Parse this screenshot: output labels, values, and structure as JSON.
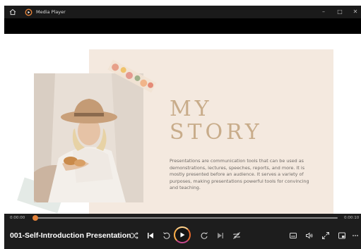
{
  "app": {
    "title": "Media Player"
  },
  "slide": {
    "heading_line1": "MY",
    "heading_line2": "STORY",
    "paragraph": "Presentations are communication tools that can be used as demonstrations, lectures, speeches, reports, and more. It is mostly presented before an audience. It serves a variety of purposes, making presentations powerful tools for convincing and teaching."
  },
  "playback": {
    "current_time": "0:00:00",
    "total_time": "0:00:10",
    "progress": 0.0,
    "media_title": "001-Self-Introduction Presentation"
  },
  "colors": {
    "accent": "#e3823a",
    "slide_beige": "#f4e9df",
    "heading": "#c8ac8a",
    "bar_bg": "#1d1d1d"
  },
  "icons": [
    "home-icon",
    "media-player-logo-icon",
    "minimize-icon",
    "maximize-icon",
    "close-icon",
    "shuffle-icon",
    "previous-icon",
    "rewind-10-icon",
    "play-icon",
    "forward-30-icon",
    "next-icon",
    "repeat-icon",
    "subtitles-icon",
    "volume-icon",
    "fullscreen-icon",
    "miniplayer-icon",
    "more-icon"
  ]
}
